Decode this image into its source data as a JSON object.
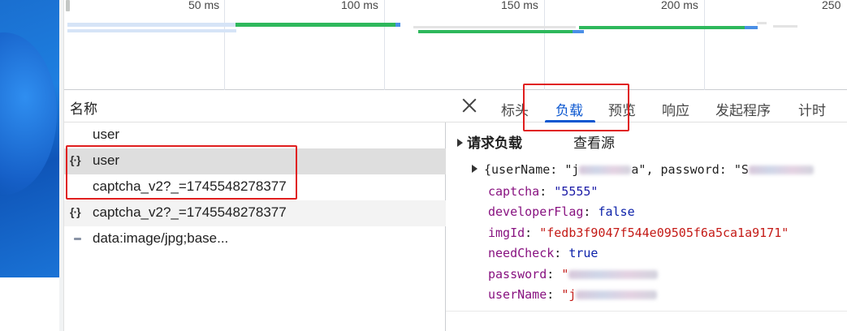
{
  "timeline": {
    "ticks": [
      "50 ms",
      "100 ms",
      "150 ms",
      "200 ms",
      "250"
    ]
  },
  "requests": {
    "header": "名称",
    "rows": [
      {
        "icon": "",
        "name": "user"
      },
      {
        "icon": "{·}",
        "name": "user"
      },
      {
        "icon": "",
        "name": "captcha_v2?_=1745548278377"
      },
      {
        "icon": "{·}",
        "name": "captcha_v2?_=1745548278377"
      },
      {
        "icon": "image",
        "name": "data:image/jpg;base..."
      }
    ]
  },
  "details": {
    "tabs": [
      "标头",
      "负载",
      "预览",
      "响应",
      "发起程序",
      "计时"
    ],
    "active_tab": "负载",
    "section_title": "请求负载",
    "view_source": "查看源",
    "summary": {
      "open": "{userName: \"j",
      "mid": "a\", password: \"S"
    },
    "props": [
      {
        "key": "captcha",
        "value": "\"5555\"",
        "type": "string"
      },
      {
        "key": "developerFlag",
        "value": "false",
        "type": "bool"
      },
      {
        "key": "imgId",
        "value": "\"fedb3f9047f544e09505f6a5ca1a9171\"",
        "type": "string"
      },
      {
        "key": "needCheck",
        "value": "true",
        "type": "bool"
      },
      {
        "key": "password",
        "value": "\"",
        "type": "redacted"
      },
      {
        "key": "userName",
        "value": "\"j",
        "type": "redacted"
      }
    ]
  },
  "colors": {
    "accent": "#0b57d0",
    "annotation": "#e01e1e",
    "key": "#881280",
    "string": "#c41a16"
  }
}
